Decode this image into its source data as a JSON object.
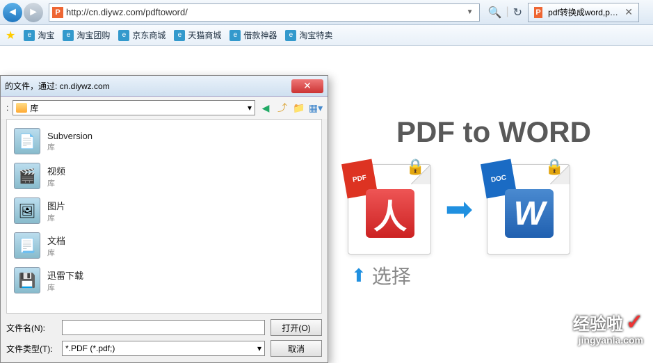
{
  "browser": {
    "url": "http://cn.diywz.com/pdftoword/",
    "tab_title": "pdf转换成word,pdf转wor...",
    "favicon_letter": "P"
  },
  "bookmarks": {
    "items": [
      {
        "label": "淘宝"
      },
      {
        "label": "淘宝团购"
      },
      {
        "label": "京东商城"
      },
      {
        "label": "天猫商城"
      },
      {
        "label": "借款神器"
      },
      {
        "label": "淘宝特卖"
      }
    ]
  },
  "page": {
    "title": "PDF to WORD",
    "pdf_ribbon": "PDF",
    "doc_ribbon": "DOC",
    "select_label": "选择"
  },
  "dialog": {
    "title": "的文件，通过: cn.diywz.com",
    "path_label": "库",
    "items": [
      {
        "name": "Subversion",
        "sub": "库",
        "emoji": "📄"
      },
      {
        "name": "视频",
        "sub": "库",
        "emoji": "🎬"
      },
      {
        "name": "图片",
        "sub": "库",
        "emoji": "🖼"
      },
      {
        "name": "文档",
        "sub": "库",
        "emoji": "📃"
      },
      {
        "name": "迅雷下载",
        "sub": "库",
        "emoji": "💾"
      }
    ],
    "filename_label": "文件名(N):",
    "filetype_label": "文件类型(T):",
    "filename_value": "",
    "filetype_value": "*.PDF (*.pdf;)",
    "open_btn": "打开(O)",
    "cancel_btn": "取消"
  },
  "watermark": {
    "main": "经验啦",
    "sub": "jingyanla.com"
  }
}
